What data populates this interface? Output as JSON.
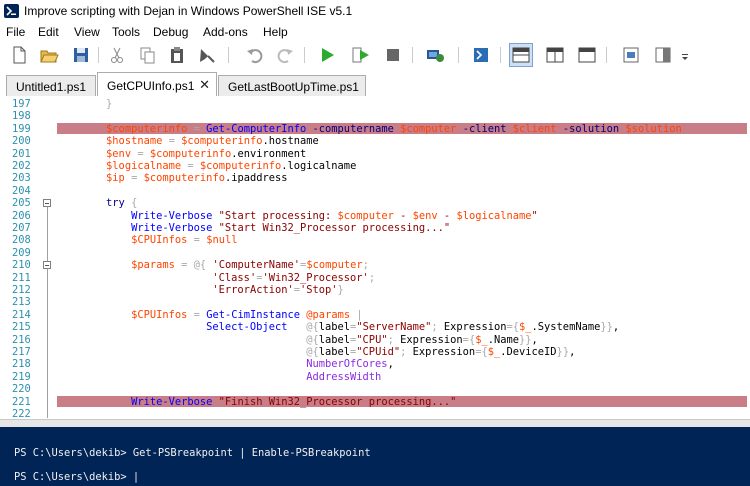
{
  "window": {
    "title": "Improve scripting with Dejan in Windows PowerShell ISE v5.1"
  },
  "menu": [
    "File",
    "Edit",
    "View",
    "Tools",
    "Debug",
    "Add-ons",
    "Help"
  ],
  "toolbar": {
    "icons": [
      "new-file-icon",
      "open-folder-icon",
      "save-icon",
      "cut-icon",
      "copy-icon",
      "paste-icon",
      "clear-console-icon",
      "undo-icon",
      "redo-icon",
      "run-script-icon",
      "run-selection-icon",
      "stop-icon",
      "new-remote-tab-icon",
      "start-powershell-icon",
      "show-script-pane-top-icon",
      "show-script-pane-right-icon",
      "show-script-pane-maximized-icon",
      "show-command-window-icon",
      "show-command-addon-icon"
    ]
  },
  "tabs": [
    {
      "label": "Untitled1.ps1",
      "active": false
    },
    {
      "label": "GetCPUInfo.ps1",
      "active": true
    },
    {
      "label": "GetLastBootUpTime.ps1",
      "active": false
    }
  ],
  "colors": {
    "breakpoint": "#c97d86",
    "console_bg": "#012456",
    "line_number": "#2b91af",
    "variable": "#ff4500",
    "command": "#0000ff",
    "string": "#8b0000",
    "keyword": "#00008b",
    "property": "#8a2be2"
  },
  "editor": {
    "lines": [
      {
        "n": "197",
        "text": "        }"
      },
      {
        "n": "198",
        "text": ""
      },
      {
        "n": "199",
        "text": "        $computerinfo = Get-ComputerInfo -computername $computer -client $client -solution $solution",
        "breakpoint": true
      },
      {
        "n": "200",
        "text": "        $hostname = $computerinfo.hostname"
      },
      {
        "n": "201",
        "text": "        $env = $computerinfo.environment"
      },
      {
        "n": "202",
        "text": "        $logicalname = $computerinfo.logicalname"
      },
      {
        "n": "203",
        "text": "        $ip = $computerinfo.ipaddress"
      },
      {
        "n": "204",
        "text": ""
      },
      {
        "n": "205",
        "text": "        try {",
        "fold": true
      },
      {
        "n": "206",
        "text": "            Write-Verbose \"Start processing: $computer - $env - $logicalname\""
      },
      {
        "n": "207",
        "text": "            Write-Verbose \"Start Win32_Processor processing...\""
      },
      {
        "n": "208",
        "text": "            $CPUInfos = $null"
      },
      {
        "n": "209",
        "text": ""
      },
      {
        "n": "210",
        "text": "            $params = @{ 'ComputerName'=$computer;",
        "fold": true
      },
      {
        "n": "211",
        "text": "                         'Class'='Win32_Processor';"
      },
      {
        "n": "212",
        "text": "                         'ErrorAction'='Stop'}"
      },
      {
        "n": "213",
        "text": ""
      },
      {
        "n": "214",
        "text": "            $CPUInfos = Get-CimInstance @params |"
      },
      {
        "n": "215",
        "text": "                        Select-Object   @{label=\"ServerName\"; Expression={$_.SystemName}},"
      },
      {
        "n": "216",
        "text": "                                        @{label=\"CPU\"; Expression={$_.Name}},"
      },
      {
        "n": "217",
        "text": "                                        @{label=\"CPUid\"; Expression={$_.DeviceID}},"
      },
      {
        "n": "218",
        "text": "                                        NumberOfCores,"
      },
      {
        "n": "219",
        "text": "                                        AddressWidth"
      },
      {
        "n": "220",
        "text": ""
      },
      {
        "n": "221",
        "text": "            Write-Verbose \"Finish Win32_Processor processing...\"",
        "breakpoint": true
      },
      {
        "n": "222",
        "text": ""
      }
    ]
  },
  "console": {
    "lines": [
      "PS C:\\Users\\dekib> Get-PSBreakpoint | Enable-PSBreakpoint",
      "",
      "PS C:\\Users\\dekib> |"
    ]
  }
}
